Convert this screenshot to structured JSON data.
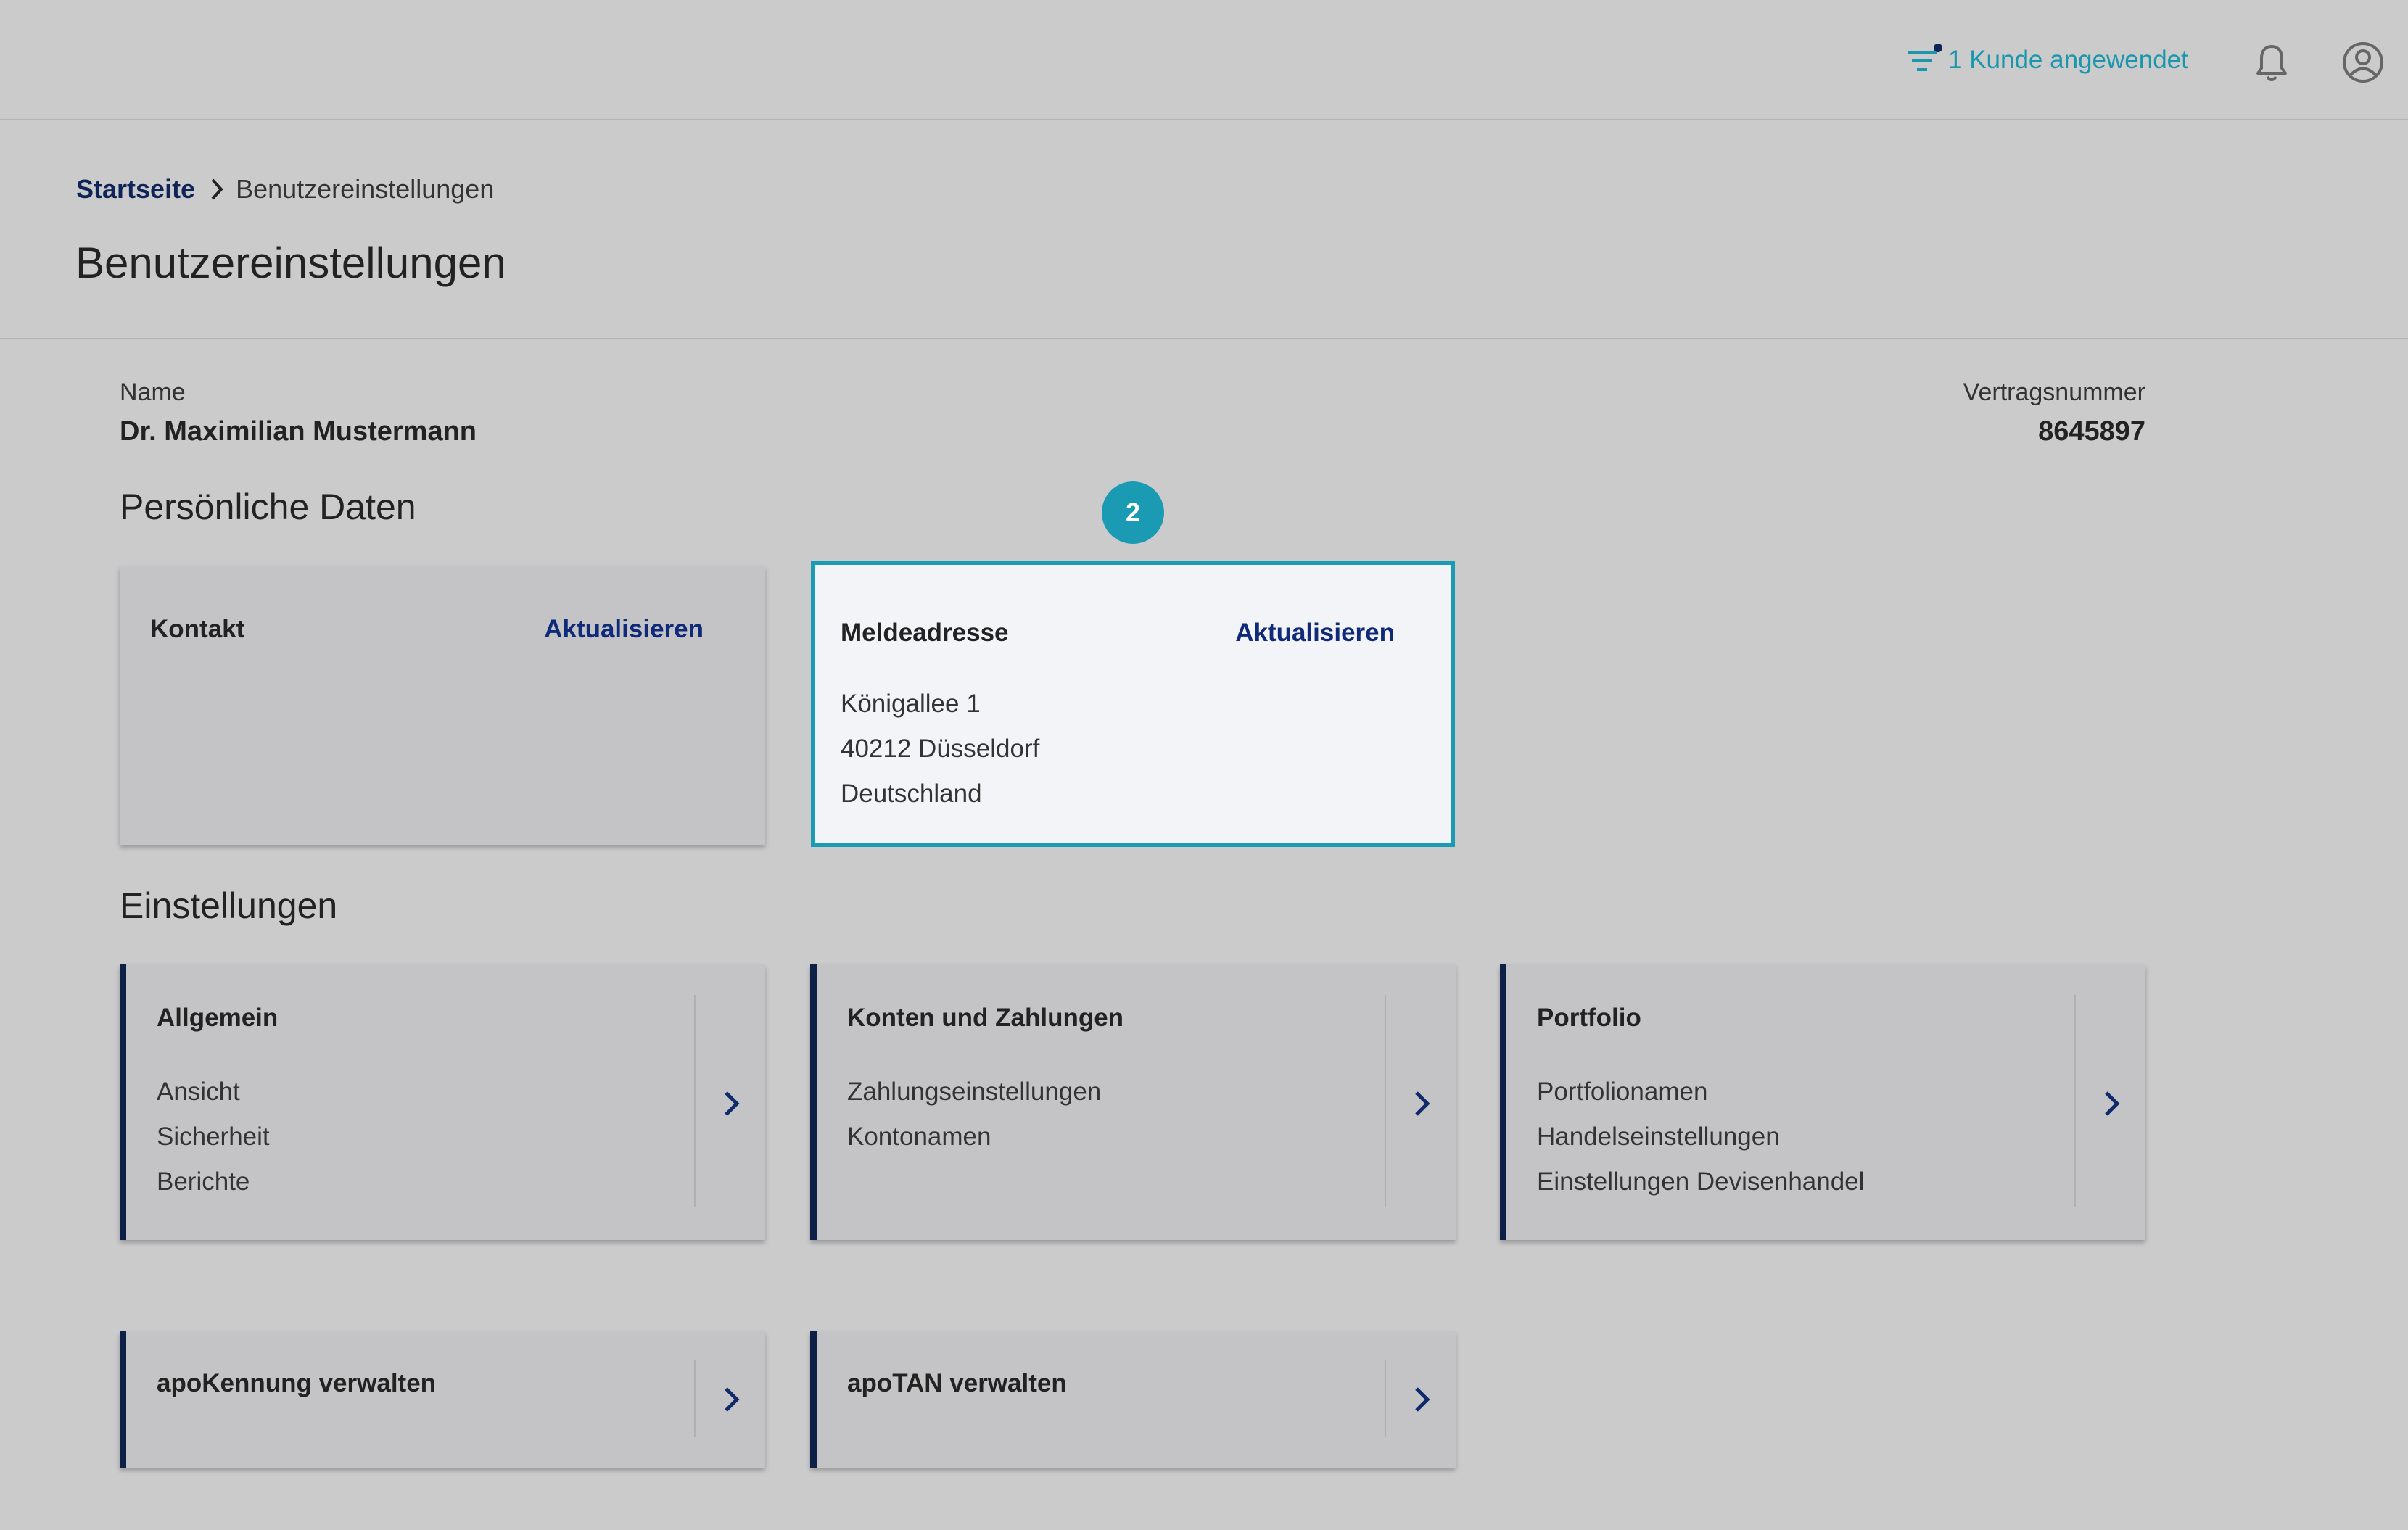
{
  "header": {
    "filter_label": "1 Kunde angewendet",
    "accent_color": "#1a96ad",
    "icons": [
      "filter-icon",
      "bell-icon",
      "user-circle-icon"
    ]
  },
  "breadcrumb": {
    "home": "Startseite",
    "current": "Benutzereinstellungen"
  },
  "page_title": "Benutzereinstellungen",
  "profile": {
    "name_label": "Name",
    "name_value": "Dr. Maximilian Mustermann",
    "contract_label": "Vertragsnummer",
    "contract_value": "8645897"
  },
  "personal": {
    "section_title": "Persönliche Daten",
    "step_badge": "2",
    "contact": {
      "title": "Kontakt",
      "action": "Aktualisieren"
    },
    "address": {
      "title": "Meldeadresse",
      "action": "Aktualisieren",
      "lines": [
        "Königallee 1",
        "40212 Düsseldorf",
        "Deutschland"
      ]
    }
  },
  "settings": {
    "section_title": "Einstellungen",
    "cards": [
      {
        "title": "Allgemein",
        "items": [
          "Ansicht",
          "Sicherheit",
          "Berichte"
        ]
      },
      {
        "title": "Konten und Zahlungen",
        "items": [
          "Zahlungseinstellungen",
          "Kontonamen"
        ]
      },
      {
        "title": "Portfolio",
        "items": [
          "Portfolionamen",
          "Handelseinstellungen",
          "Einstellungen Devisenhandel"
        ]
      }
    ],
    "manage": [
      {
        "title": "apoKennung verwalten"
      },
      {
        "title": "apoTAN verwalten"
      }
    ]
  }
}
